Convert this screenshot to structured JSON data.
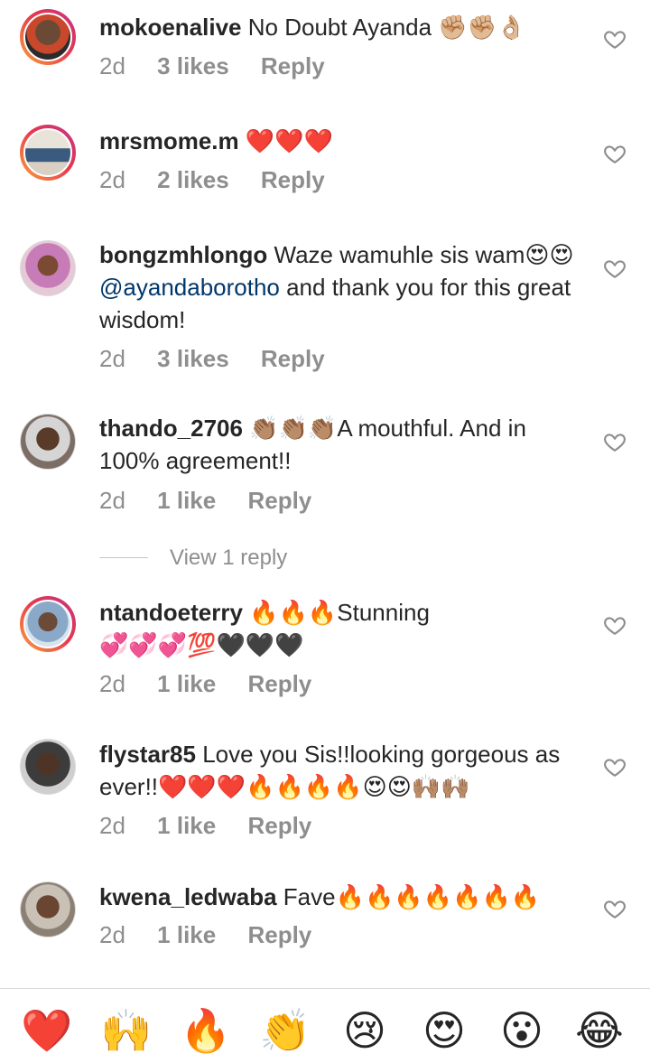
{
  "comments": [
    {
      "username": "mokoenalive",
      "text": "No Doubt Ayanda ",
      "emojis": "✊🏼✊🏼👌🏼",
      "time": "2d",
      "likes": "3 likes",
      "reply": "Reply",
      "story": true
    },
    {
      "username": "mrsmome.m",
      "text": " ",
      "emojis": "❤️❤️❤️",
      "time": "2d",
      "likes": "2 likes",
      "reply": "Reply",
      "story": true
    },
    {
      "username": "bongzmhlongo",
      "text_a": "Waze wamuhle sis wam",
      "emojis": "😍😍",
      "mention": "@ayandaborotho",
      "text_b": " and thank you for this great wisdom!",
      "time": "2d",
      "likes": "3 likes",
      "reply": "Reply",
      "story": false
    },
    {
      "username": "thando_2706",
      "emojis": "👏🏽👏🏽👏🏽",
      "text": "A mouthful. And in 100% agreement!!",
      "time": "2d",
      "likes": "1 like",
      "reply": "Reply",
      "story": false,
      "view_replies": "View 1 reply"
    },
    {
      "username": "ntandoeterry",
      "emojis_a": "🔥🔥🔥",
      "text": "Stunning",
      "emojis_b": "💞💞💞💯🖤🖤🖤",
      "time": "2d",
      "likes": "1 like",
      "reply": "Reply",
      "story": true
    },
    {
      "username": "flystar85",
      "text": "Love you Sis!!looking gorgeous as ever!!",
      "emojis": "❤️❤️❤️🔥🔥🔥🔥😍😍🙌🏽🙌🏽",
      "time": "2d",
      "likes": "1 like",
      "reply": "Reply",
      "story": false
    },
    {
      "username": "kwena_ledwaba",
      "text": "Fave",
      "emojis": "🔥🔥🔥🔥🔥🔥🔥",
      "time": "2d",
      "likes": "1 like",
      "reply": "Reply",
      "story": false
    }
  ],
  "quick_reactions": [
    "❤️",
    "🙌",
    "🔥",
    "👏",
    "😢",
    "😍",
    "😮",
    "😂"
  ],
  "colors": {
    "mention": "#00376b",
    "meta": "#8e8e8e",
    "username": "#262626"
  }
}
